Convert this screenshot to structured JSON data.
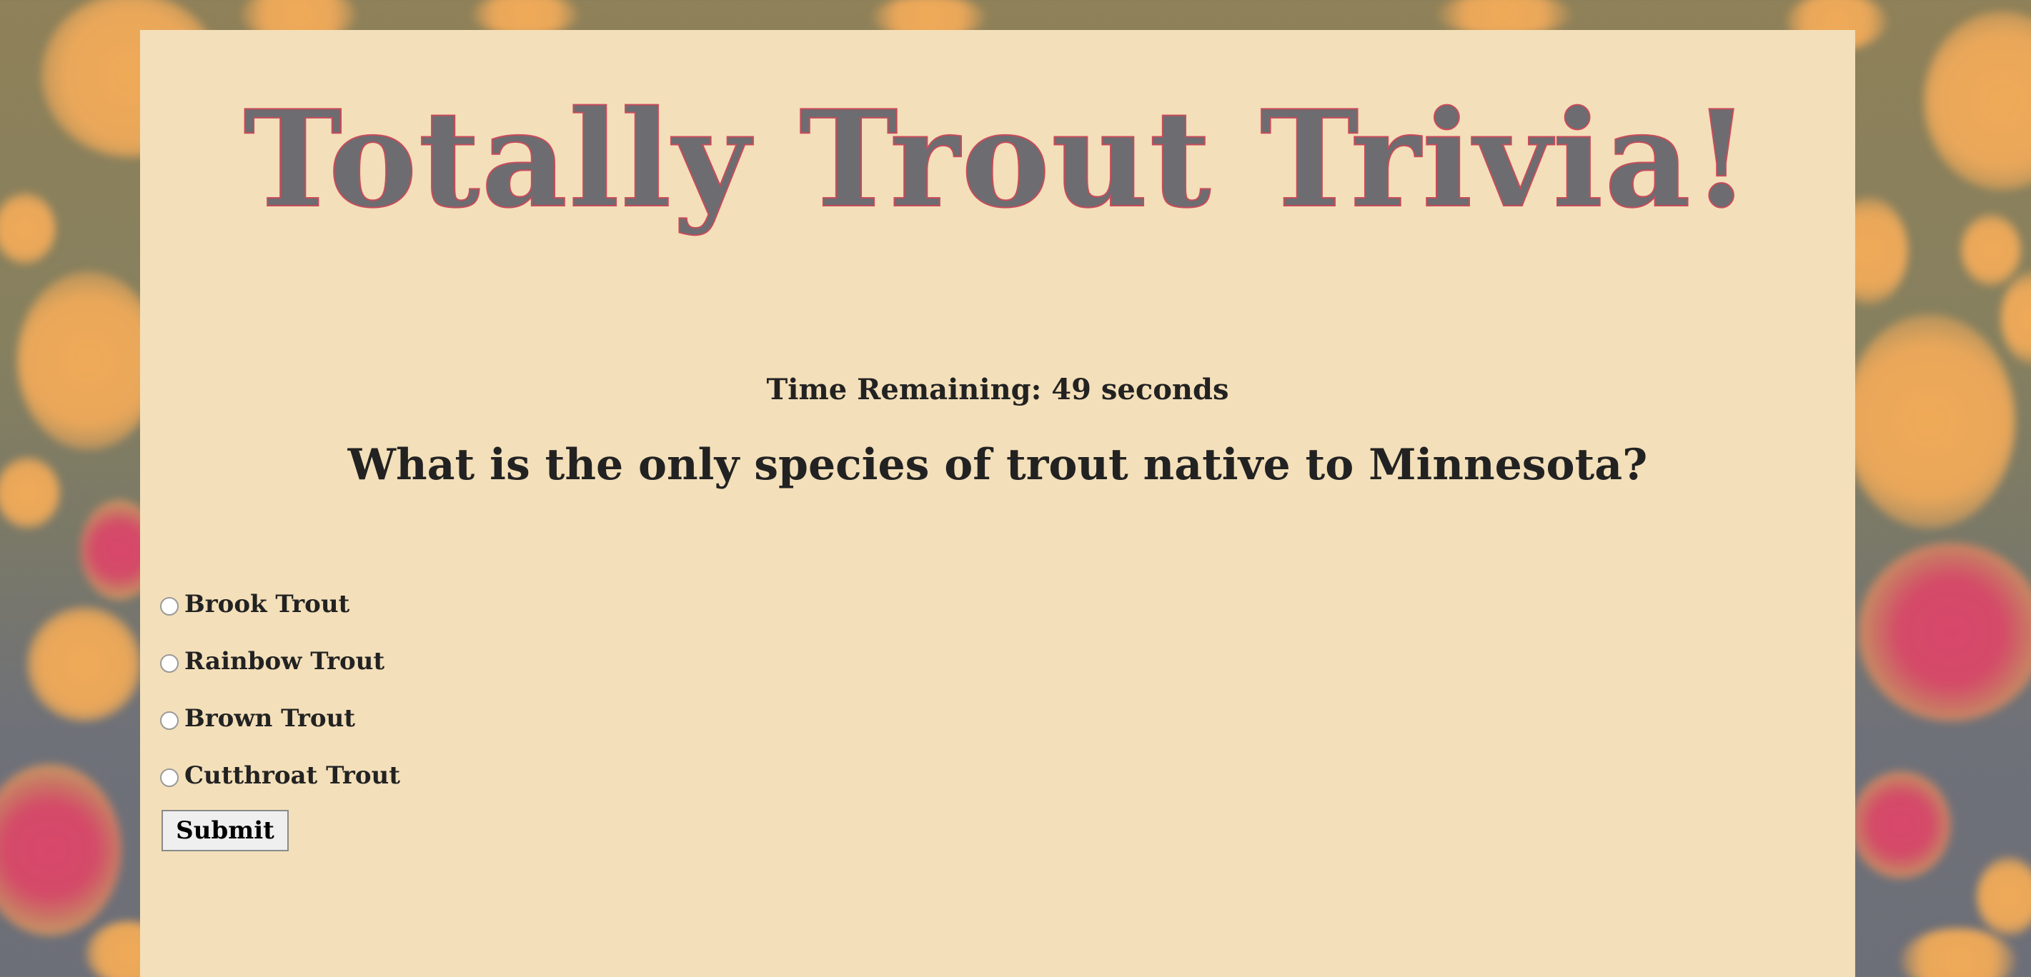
{
  "page": {
    "title": "Totally Trout Trivia!"
  },
  "quiz": {
    "timer_text": "Time Remaining: 49 seconds",
    "question": "What is the only species of trout native to Minnesota?",
    "answers": [
      {
        "label": "Brook Trout"
      },
      {
        "label": "Rainbow Trout"
      },
      {
        "label": "Brown Trout"
      },
      {
        "label": "Cutthroat Trout"
      }
    ],
    "submit_label": "Submit"
  },
  "colors": {
    "background": "#8f8159",
    "panel": "#f3dfb9",
    "title_fill": "#6d6c71",
    "title_outline": "#c84b5b",
    "spot_orange": "#f0aa58",
    "spot_red": "#d8476a",
    "text": "#222222"
  }
}
